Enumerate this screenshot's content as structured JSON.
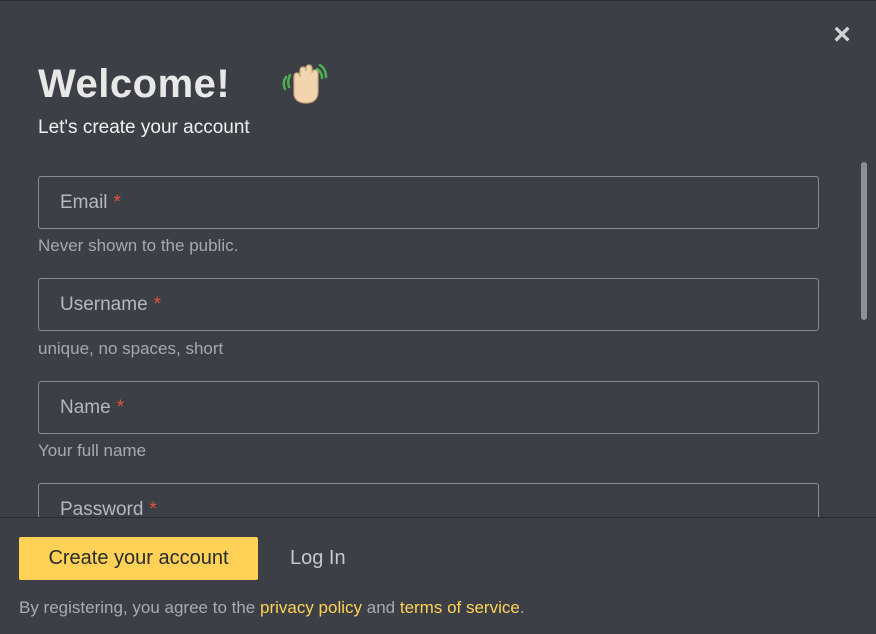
{
  "header": {
    "title": "Welcome!",
    "subtitle": "Let's create your account",
    "close_icon": "×"
  },
  "fields": [
    {
      "label": "Email",
      "required": "*",
      "hint": "Never shown to the public."
    },
    {
      "label": "Username",
      "required": "*",
      "hint": "unique, no spaces, short"
    },
    {
      "label": "Name",
      "required": "*",
      "hint": "Your full name"
    },
    {
      "label": "Password",
      "required": "*"
    }
  ],
  "footer": {
    "create_label": "Create your account",
    "login_label": "Log In",
    "legal_prefix": "By registering, you agree to the ",
    "privacy_label": "privacy policy",
    "legal_and": " and ",
    "terms_label": "terms of service",
    "legal_suffix": "."
  },
  "colors": {
    "background": "#3c3f45",
    "accent": "#ffd257",
    "required": "#e3513a"
  },
  "icons": {
    "close": "close-icon",
    "wave": "waving-hand-icon"
  }
}
